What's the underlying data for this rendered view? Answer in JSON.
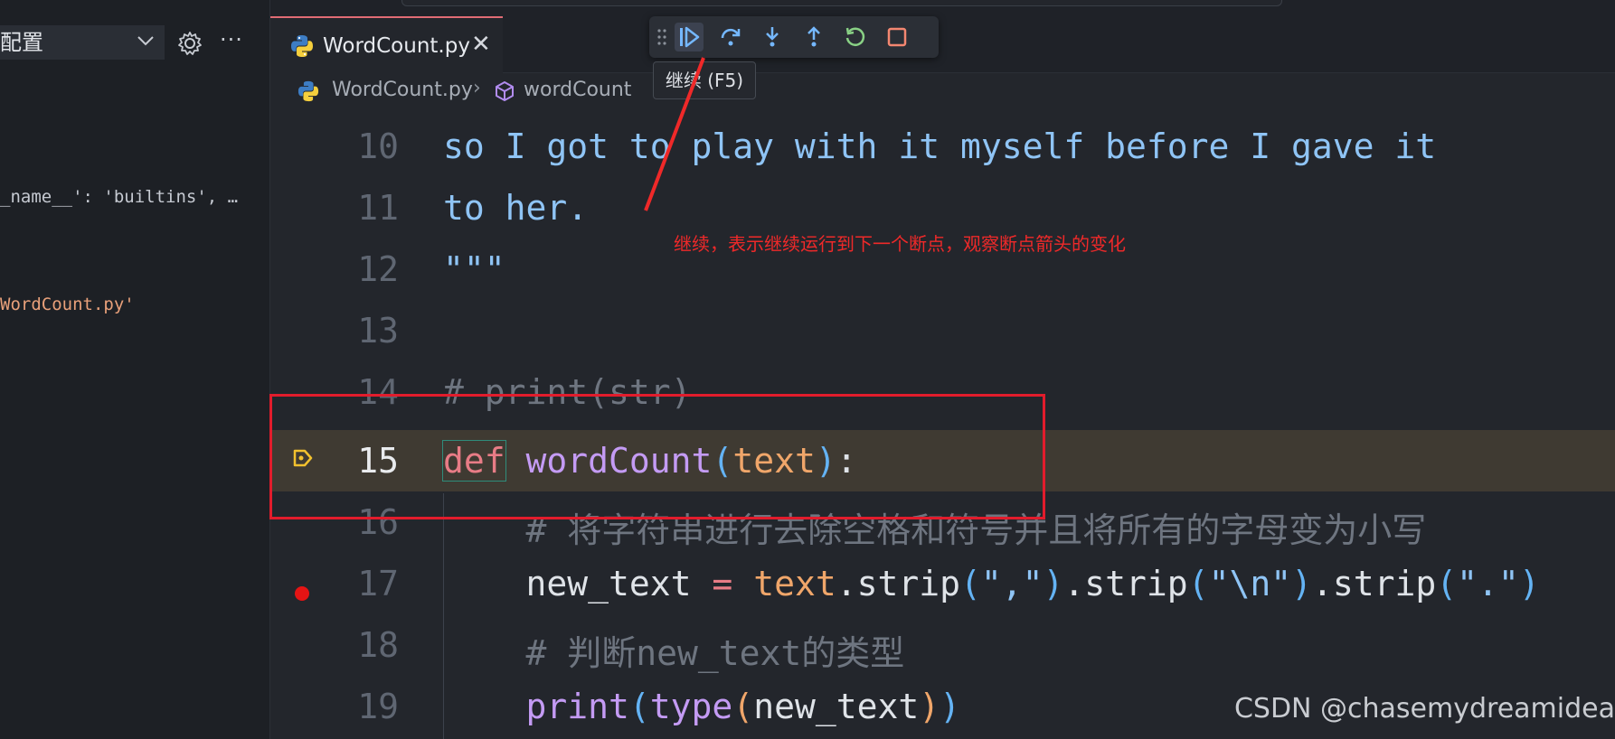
{
  "sidebar": {
    "config_label": "配置",
    "more_label": "···",
    "variables": [
      "_name__': 'builtins', …",
      "WordCount.py'"
    ]
  },
  "tab": {
    "filename": "WordCount.py",
    "close_label": "✕"
  },
  "breadcrumb": {
    "file": "WordCount.py",
    "separator": "›",
    "symbol": "wordCount"
  },
  "debug_toolbar": {
    "buttons": [
      "continue",
      "step-over",
      "step-into",
      "step-out",
      "restart",
      "stop"
    ],
    "tooltip": "继续 (F5)"
  },
  "editor": {
    "current_line": 15,
    "breakpoint_lines": [
      17
    ],
    "lines": [
      {
        "num": "10",
        "text": "so I got to play with it myself before I gave it"
      },
      {
        "num": "11",
        "text": "to her."
      },
      {
        "num": "12",
        "text": "\"\"\""
      },
      {
        "num": "13",
        "text": ""
      },
      {
        "num": "14",
        "text": "# print(str)"
      },
      {
        "num": "15",
        "text": "def wordCount(text):"
      },
      {
        "num": "16",
        "text": "    # 将字符串进行去除空格和符号并且将所有的字母变为小写"
      },
      {
        "num": "17",
        "text": "    new_text = text.strip(\",\").strip(\"\\n\").strip(\".\")"
      },
      {
        "num": "18",
        "text": "    # 判断new_text的类型"
      },
      {
        "num": "19",
        "text": "    print(type(new_text))"
      }
    ]
  },
  "annotation": {
    "note": "继续，表示继续运行到下一个断点，观察断点箭头的变化",
    "color": "#ef2929"
  },
  "watermark": "CSDN @chasemydreamidea"
}
